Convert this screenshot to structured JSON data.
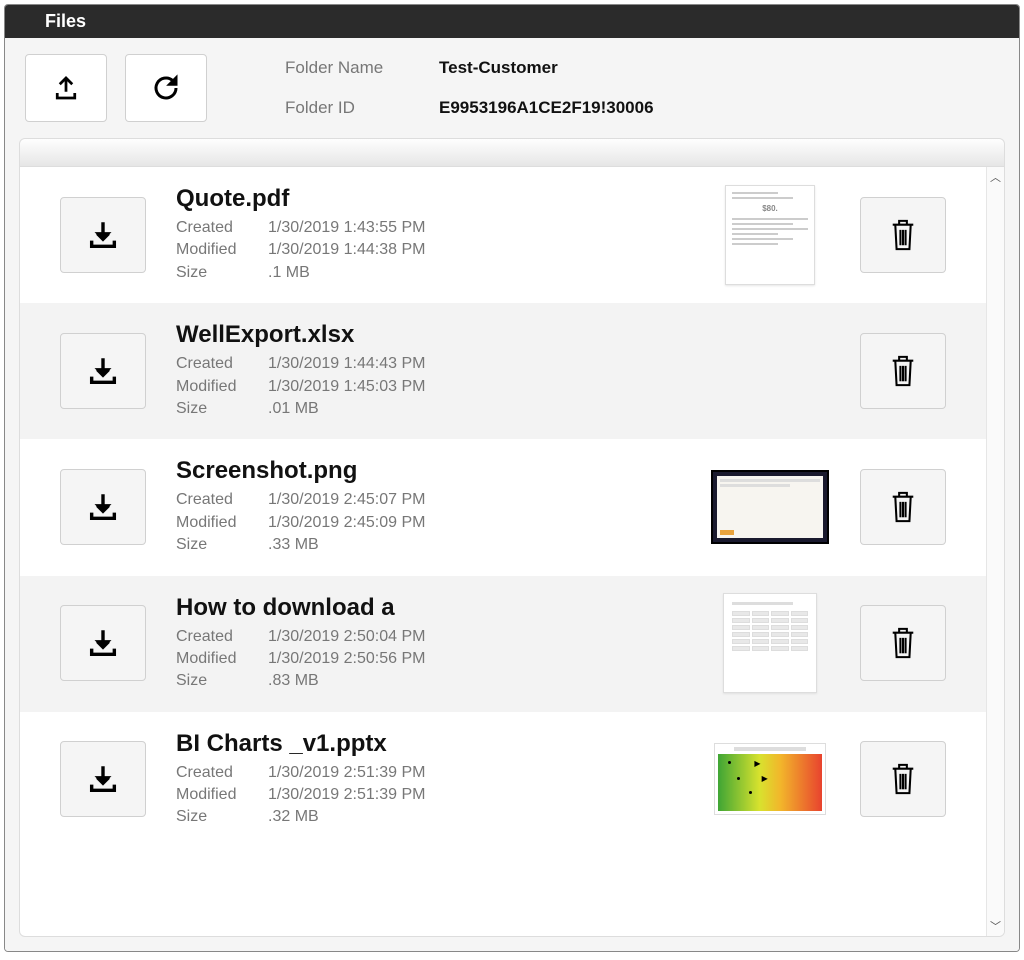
{
  "title": "Files",
  "folder": {
    "name_label": "Folder Name",
    "name": "Test-Customer",
    "id_label": "Folder ID",
    "id": "E9953196A1CE2F19!30006"
  },
  "labels": {
    "created": "Created",
    "modified": "Modified",
    "size": "Size"
  },
  "files": [
    {
      "name": "Quote.pdf",
      "created": "1/30/2019 1:43:55 PM",
      "modified": "1/30/2019 1:44:38 PM",
      "size": ".1 MB",
      "thumb": "doc"
    },
    {
      "name": "WellExport.xlsx",
      "created": "1/30/2019 1:44:43 PM",
      "modified": "1/30/2019 1:45:03 PM",
      "size": ".01 MB",
      "thumb": "none"
    },
    {
      "name": "Screenshot.png",
      "created": "1/30/2019 2:45:07 PM",
      "modified": "1/30/2019 2:45:09 PM",
      "size": ".33 MB",
      "thumb": "screenshot"
    },
    {
      "name": "How to download a",
      "created": "1/30/2019 2:50:04 PM",
      "modified": "1/30/2019 2:50:56 PM",
      "size": ".83 MB",
      "thumb": "table"
    },
    {
      "name": "BI Charts _v1.pptx",
      "created": "1/30/2019 2:51:39 PM",
      "modified": "1/30/2019 2:51:39 PM",
      "size": ".32 MB",
      "thumb": "chart"
    }
  ]
}
